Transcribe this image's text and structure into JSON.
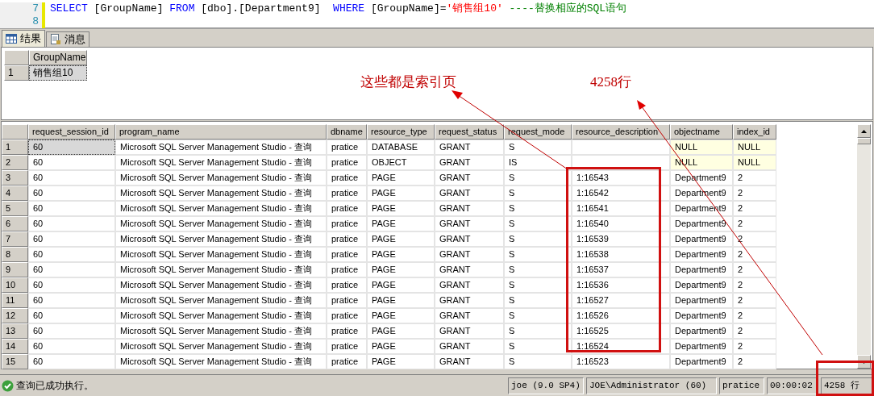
{
  "editor": {
    "lines": [
      {
        "number": "7",
        "tokens": [
          {
            "kind": "keyword",
            "text": "SELECT"
          },
          {
            "kind": "plain",
            "text": " [GroupName] "
          },
          {
            "kind": "keyword",
            "text": "FROM"
          },
          {
            "kind": "plain",
            "text": " [dbo].[Department9]  "
          },
          {
            "kind": "keyword",
            "text": "WHERE"
          },
          {
            "kind": "plain",
            "text": " [GroupName]="
          },
          {
            "kind": "string",
            "text": "'销售组10'"
          },
          {
            "kind": "comment",
            "text": " ----替换相应的SQL语句"
          }
        ]
      },
      {
        "number": "8"
      }
    ]
  },
  "tabs": [
    {
      "label": "结果",
      "selected": true
    },
    {
      "label": "消息",
      "selected": false
    }
  ],
  "result_grid": {
    "columns": [
      "GroupName"
    ],
    "rows": [
      {
        "number": "1",
        "focused": true,
        "cells": [
          "销售组10"
        ]
      }
    ]
  },
  "locks_grid": {
    "columns": [
      "request_session_id",
      "program_name",
      "dbname",
      "resource_type",
      "request_status",
      "request_mode",
      "resource_description",
      "objectname",
      "index_id"
    ],
    "rows": [
      {
        "number": "1",
        "focused": true,
        "nulls": true,
        "cells": [
          "60",
          "Microsoft SQL Server Management Studio - 查询",
          "pratice",
          "DATABASE",
          "GRANT",
          "S",
          "",
          "NULL",
          "NULL"
        ]
      },
      {
        "number": "2",
        "focused": false,
        "nulls": true,
        "cells": [
          "60",
          "Microsoft SQL Server Management Studio - 查询",
          "pratice",
          "OBJECT",
          "GRANT",
          "IS",
          "",
          "NULL",
          "NULL"
        ]
      },
      {
        "number": "3",
        "focused": false,
        "nulls": false,
        "cells": [
          "60",
          "Microsoft SQL Server Management Studio - 查询",
          "pratice",
          "PAGE",
          "GRANT",
          "S",
          "1:16543",
          "Department9",
          "2"
        ]
      },
      {
        "number": "4",
        "focused": false,
        "nulls": false,
        "cells": [
          "60",
          "Microsoft SQL Server Management Studio - 查询",
          "pratice",
          "PAGE",
          "GRANT",
          "S",
          "1:16542",
          "Department9",
          "2"
        ]
      },
      {
        "number": "5",
        "focused": false,
        "nulls": false,
        "cells": [
          "60",
          "Microsoft SQL Server Management Studio - 查询",
          "pratice",
          "PAGE",
          "GRANT",
          "S",
          "1:16541",
          "Department9",
          "2"
        ]
      },
      {
        "number": "6",
        "focused": false,
        "nulls": false,
        "cells": [
          "60",
          "Microsoft SQL Server Management Studio - 查询",
          "pratice",
          "PAGE",
          "GRANT",
          "S",
          "1:16540",
          "Department9",
          "2"
        ]
      },
      {
        "number": "7",
        "focused": false,
        "nulls": false,
        "cells": [
          "60",
          "Microsoft SQL Server Management Studio - 查询",
          "pratice",
          "PAGE",
          "GRANT",
          "S",
          "1:16539",
          "Department9",
          "2"
        ]
      },
      {
        "number": "8",
        "focused": false,
        "nulls": false,
        "cells": [
          "60",
          "Microsoft SQL Server Management Studio - 查询",
          "pratice",
          "PAGE",
          "GRANT",
          "S",
          "1:16538",
          "Department9",
          "2"
        ]
      },
      {
        "number": "9",
        "focused": false,
        "nulls": false,
        "cells": [
          "60",
          "Microsoft SQL Server Management Studio - 查询",
          "pratice",
          "PAGE",
          "GRANT",
          "S",
          "1:16537",
          "Department9",
          "2"
        ]
      },
      {
        "number": "10",
        "focused": false,
        "nulls": false,
        "cells": [
          "60",
          "Microsoft SQL Server Management Studio - 查询",
          "pratice",
          "PAGE",
          "GRANT",
          "S",
          "1:16536",
          "Department9",
          "2"
        ]
      },
      {
        "number": "11",
        "focused": false,
        "nulls": false,
        "cells": [
          "60",
          "Microsoft SQL Server Management Studio - 查询",
          "pratice",
          "PAGE",
          "GRANT",
          "S",
          "1:16527",
          "Department9",
          "2"
        ]
      },
      {
        "number": "12",
        "focused": false,
        "nulls": false,
        "cells": [
          "60",
          "Microsoft SQL Server Management Studio - 查询",
          "pratice",
          "PAGE",
          "GRANT",
          "S",
          "1:16526",
          "Department9",
          "2"
        ]
      },
      {
        "number": "13",
        "focused": false,
        "nulls": false,
        "cells": [
          "60",
          "Microsoft SQL Server Management Studio - 查询",
          "pratice",
          "PAGE",
          "GRANT",
          "S",
          "1:16525",
          "Department9",
          "2"
        ]
      },
      {
        "number": "14",
        "focused": false,
        "nulls": false,
        "cells": [
          "60",
          "Microsoft SQL Server Management Studio - 查询",
          "pratice",
          "PAGE",
          "GRANT",
          "S",
          "1:16524",
          "Department9",
          "2"
        ]
      },
      {
        "number": "15",
        "focused": false,
        "nulls": false,
        "cells": [
          "60",
          "Microsoft SQL Server Management Studio - 查询",
          "pratice",
          "PAGE",
          "GRANT",
          "S",
          "1:16523",
          "Department9",
          "2"
        ]
      }
    ]
  },
  "annotations": [
    {
      "text": "这些都是索引页"
    },
    {
      "text": "4258行"
    }
  ],
  "status_bar": {
    "message": "查询已成功执行。",
    "server": "joe (9.0 SP4)",
    "user": "JOE\\Administrator (60)",
    "database": "pratice",
    "elapsed": "00:00:02",
    "rows": "4258 行"
  }
}
